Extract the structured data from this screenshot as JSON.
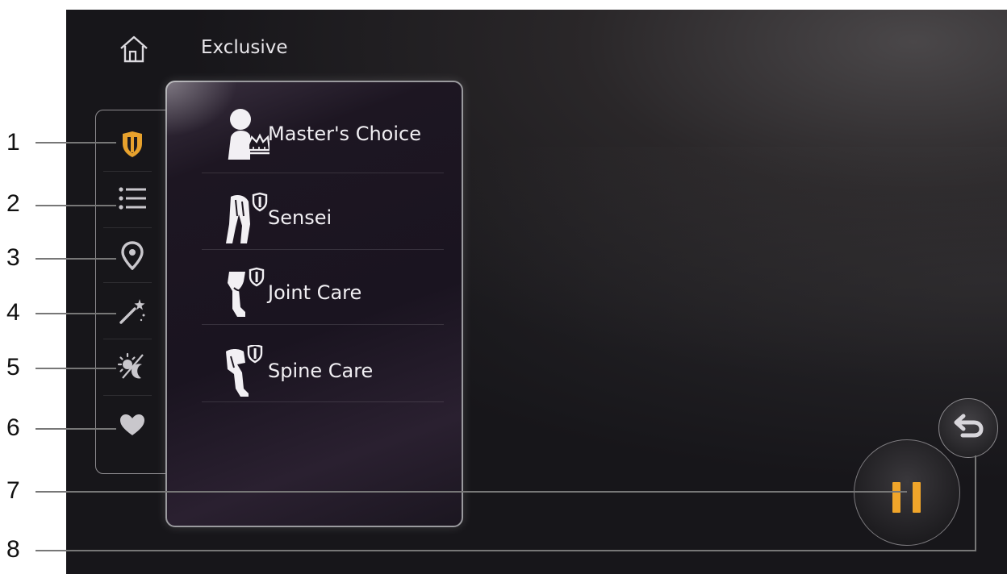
{
  "header": {
    "title": "Exclusive",
    "home_icon": "home-icon"
  },
  "sidebar": {
    "items": [
      {
        "icon": "shield-icon",
        "active": true,
        "color": "#e8a22d"
      },
      {
        "icon": "list-icon",
        "active": false
      },
      {
        "icon": "location-pin-icon",
        "active": false
      },
      {
        "icon": "magic-wand-icon",
        "active": false
      },
      {
        "icon": "sun-moon-icon",
        "active": false
      },
      {
        "icon": "heart-icon",
        "active": false
      }
    ]
  },
  "menu": {
    "items": [
      {
        "label": "Master's Choice",
        "icon": "master-crown-icon"
      },
      {
        "label": "Sensei",
        "icon": "sensei-body-icon"
      },
      {
        "label": "Joint Care",
        "icon": "legs-icon"
      },
      {
        "label": "Spine Care",
        "icon": "seated-body-icon"
      }
    ]
  },
  "controls": {
    "pause_icon": "pause-icon",
    "back_icon": "back-arrow-icon",
    "accent": "#f0a52a"
  },
  "callouts": [
    "1",
    "2",
    "3",
    "4",
    "5",
    "6",
    "7",
    "8"
  ]
}
